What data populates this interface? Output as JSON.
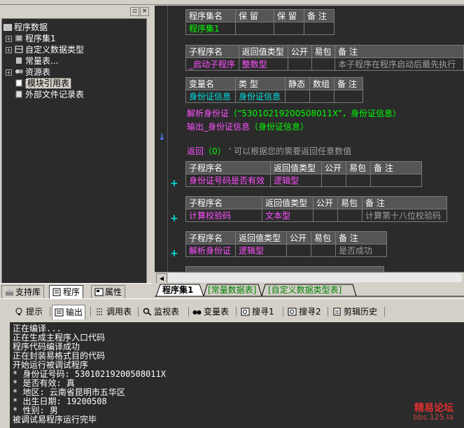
{
  "left_panel": {
    "tree": [
      {
        "label": "程序数据",
        "expander": "",
        "icon": "folder-icon"
      },
      {
        "label": "程序集1",
        "expander": "+",
        "icon": "program-set-icon"
      },
      {
        "label": "自定义数据类型",
        "expander": "+",
        "icon": "datatype-icon"
      },
      {
        "label": "常量表...",
        "expander": "",
        "icon": "constant-icon"
      },
      {
        "label": "资源表",
        "expander": "+",
        "icon": "resource-icon"
      },
      {
        "label": "模块引用表",
        "expander": "",
        "icon": "module-ref-icon"
      },
      {
        "label": "外部文件记录表",
        "expander": "",
        "icon": "external-file-icon"
      }
    ],
    "tabs": [
      "支持库",
      "程序",
      "属性"
    ],
    "header_buttons": [
      "▫",
      "×"
    ]
  },
  "editor": {
    "program_set_header": [
      "程序集名",
      "保 留",
      "保 留",
      "备 注"
    ],
    "program_set_row": [
      "程序集1",
      "",
      "",
      ""
    ],
    "sub1_header": [
      "子程序名",
      "返回值类型",
      "公开",
      "易包",
      "备 注"
    ],
    "sub1_row": [
      "_启动子程序",
      "整数型",
      "",
      "",
      "本子程序在程序启动后最先执行"
    ],
    "var_header": [
      "变量名",
      "类 型",
      "静态",
      "数组",
      "备 注"
    ],
    "var_row": [
      "身份证信息",
      "身份证信息",
      "",
      "",
      ""
    ],
    "code_line1_fn": "解析身份证",
    "code_line1_args": "（“53010219200508011X”，身份证信息）",
    "code_line2_fn": "输出_身份证信息",
    "code_line2_args": "（身份证信息）",
    "return_keyword": "返回",
    "return_args": "（0）",
    "return_comment": "’ 可以根据您的需要返回任意数值",
    "sub2_header": [
      "子程序名",
      "返回值类型",
      "公开",
      "易包",
      "备 注"
    ],
    "sub2_row": [
      "身份证号码是否有效",
      "逻辑型",
      "",
      "",
      ""
    ],
    "sub3_header": [
      "子程序名",
      "返回值类型",
      "公开",
      "易包",
      "备 注"
    ],
    "sub3_row": [
      "计算校验码",
      "文本型",
      "",
      "",
      "计算第十八位校验码"
    ],
    "sub4_header": [
      "子程序名",
      "返回值类型",
      "公开",
      "易包",
      "备 注"
    ],
    "sub4_row": [
      "解析身份证",
      "逻辑型",
      "",
      "",
      "是否成功"
    ],
    "code_tabs": [
      "程序集1",
      "[常量数据表]",
      "[自定义数据类型表]"
    ]
  },
  "bottom": {
    "tabs": [
      "提示",
      "输出",
      "调用表",
      "监视表",
      "变量表",
      "搜寻1",
      "搜寻2",
      "剪辑历史"
    ],
    "output_lines": [
      "正在编译...",
      "正在生成主程序入口代码",
      "程序代码编译成功",
      "正在封装易格式目的代码",
      "开始运行被调试程序",
      "* 身份证号码: 53010219200508011X",
      "* 是否有效: 真",
      "* 地区: 云南省昆明市五华区",
      "* 出生日期: 19200508",
      "* 性别: 男",
      "被调试易程序运行完毕"
    ]
  },
  "watermark": {
    "line1": "精易论坛",
    "line2": "bbs.125.la"
  },
  "colors": {
    "editor_bg": "#2b2b2b",
    "keyword_green": "#00ff00",
    "keyword_magenta": "#ff50ff",
    "keyword_cyan": "#00e0e0"
  }
}
